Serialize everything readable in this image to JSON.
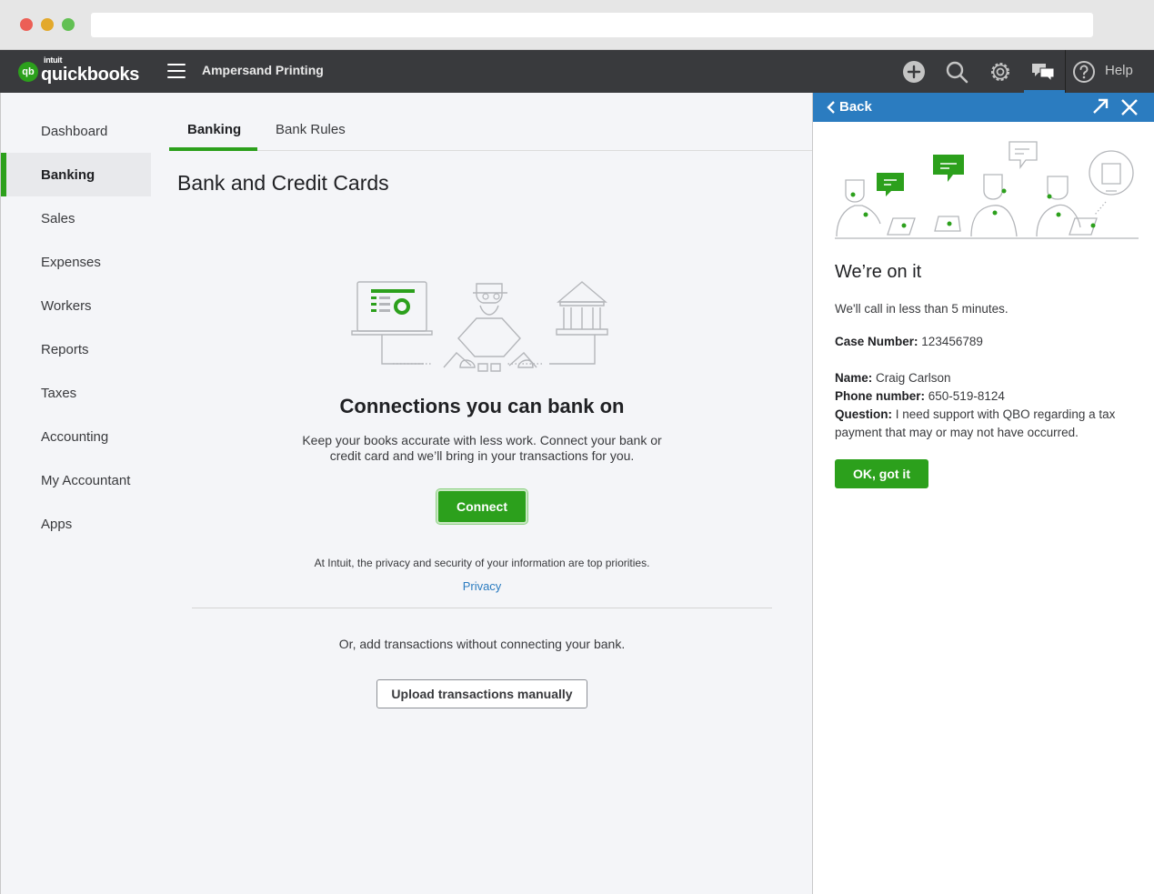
{
  "app": {
    "logo_small": "intuit",
    "logo_text": "quickbooks",
    "logo_badge": "qb",
    "company": "Ampersand Printing",
    "help_label": "Help"
  },
  "icons": {
    "add": "plus-circle-icon",
    "search": "search-icon",
    "settings": "gear-icon",
    "chat": "chat-bubbles-icon",
    "help": "question-circle-icon"
  },
  "colors": {
    "brand_green": "#2ca01c",
    "topbar": "#393a3d",
    "panel_blue": "#2b7cc0"
  },
  "sidebar": {
    "items": [
      {
        "label": "Dashboard"
      },
      {
        "label": "Banking"
      },
      {
        "label": "Sales"
      },
      {
        "label": "Expenses"
      },
      {
        "label": "Workers"
      },
      {
        "label": "Reports"
      },
      {
        "label": "Taxes"
      },
      {
        "label": "Accounting"
      },
      {
        "label": "My Accountant"
      },
      {
        "label": "Apps"
      }
    ],
    "active": "Banking"
  },
  "main": {
    "tabs": [
      {
        "label": "Banking"
      },
      {
        "label": "Bank Rules"
      }
    ],
    "page_title": "Bank and Credit Cards",
    "connect_title": "Connections you can bank on",
    "connect_desc": "Keep your books accurate with less work. Connect your bank or credit card and we’ll bring in your transactions for you.",
    "connect_button": "Connect",
    "privacy_note": "At Intuit, the privacy and security of your information are top priorities.",
    "privacy_link": "Privacy",
    "or_text": "Or, add transactions without connecting your bank.",
    "upload_button": "Upload transactions manually"
  },
  "panel": {
    "back_label": "Back",
    "title": "We’re on it",
    "call_text": "We'll call in less than 5 minutes.",
    "case_label": "Case Number:",
    "case_value": "123456789",
    "name_label": "Name:",
    "name_value": "Craig Carlson",
    "phone_label": "Phone number:",
    "phone_value": "650-519-8124",
    "question_label": "Question:",
    "question_value": "I need support with QBO regarding a tax payment that may or may not have occurred.",
    "ok_button": "OK, got it"
  }
}
